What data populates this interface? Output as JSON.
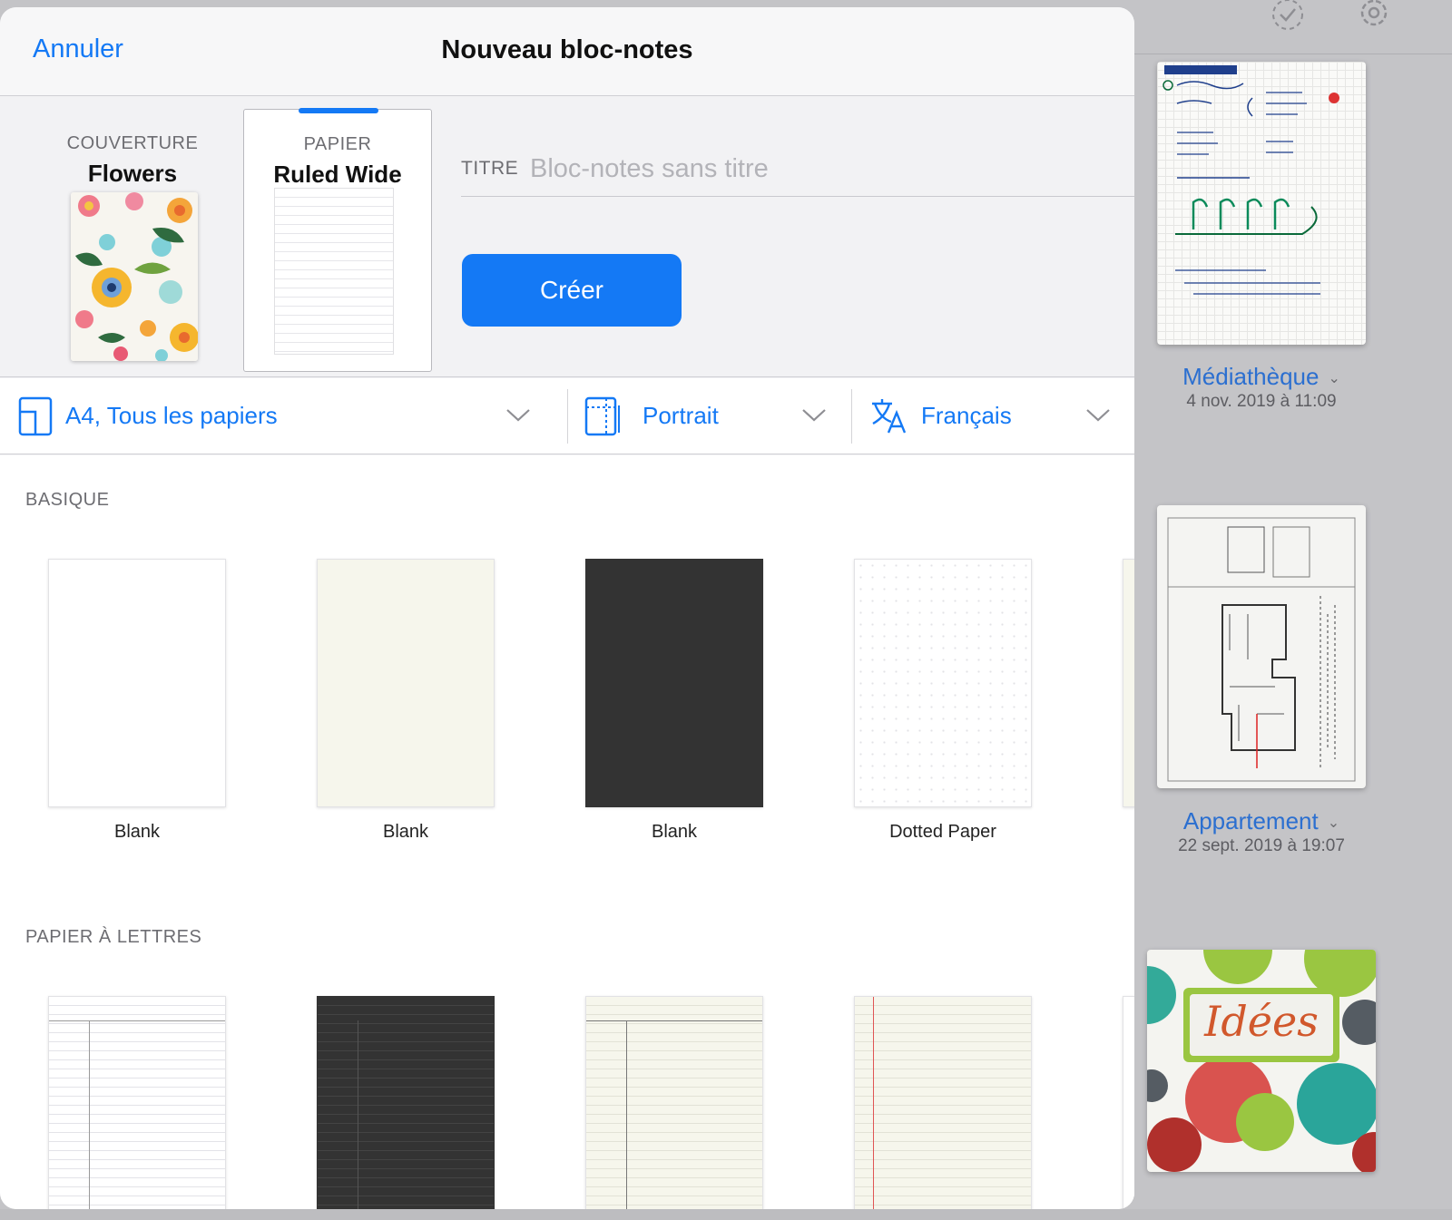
{
  "modal": {
    "cancel_label": "Annuler",
    "title": "Nouveau bloc-notes",
    "cover": {
      "kind": "COUVERTURE",
      "name": "Flowers"
    },
    "paper": {
      "kind": "PAPIER",
      "name": "Ruled Wide"
    },
    "title_field": {
      "label": "TITRE",
      "placeholder": "Bloc-notes sans titre",
      "value": ""
    },
    "create_label": "Créer",
    "options": {
      "size_label": "A4, Tous les papiers",
      "orientation_label": "Portrait",
      "language_label": "Français"
    },
    "sections": [
      {
        "heading": "BASIQUE",
        "templates": [
          {
            "name": "Blank",
            "style": "white"
          },
          {
            "name": "Blank",
            "style": "cream"
          },
          {
            "name": "Blank",
            "style": "dark"
          },
          {
            "name": "Dotted Paper",
            "style": "dotted"
          }
        ]
      },
      {
        "heading": "PAPIER À LETTRES",
        "templates": [
          {
            "name": "",
            "style": "lined-margin"
          },
          {
            "name": "",
            "style": "lined-dark"
          },
          {
            "name": "",
            "style": "lined-cream"
          },
          {
            "name": "",
            "style": "lined-red-margin"
          }
        ]
      }
    ]
  },
  "library": {
    "notebooks": [
      {
        "title": "Médiathèque",
        "date": "4 nov. 2019 à 11:09"
      },
      {
        "title": "Appartement",
        "date": "22 sept. 2019 à 19:07"
      },
      {
        "cover_text": "Idées"
      }
    ]
  },
  "colors": {
    "accent": "#1479f5",
    "sheet_bg": "#f2f2f4",
    "backdrop": "#c4c4c7"
  }
}
